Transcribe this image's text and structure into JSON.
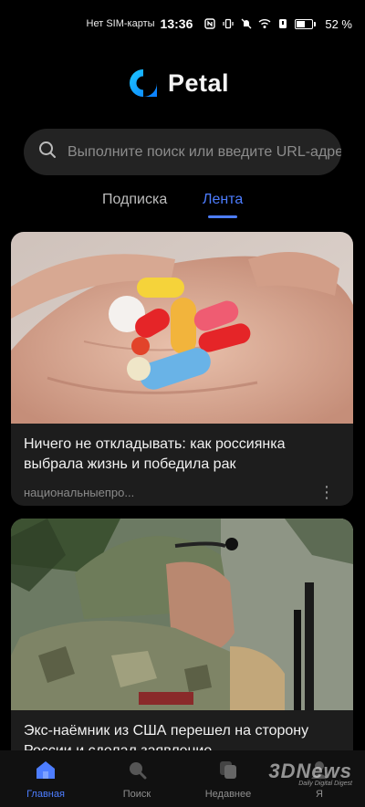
{
  "status_bar": {
    "carrier": "Нет SIM-карты",
    "time": "13:36",
    "battery_percent_text": "52 %",
    "battery_level": 0.52,
    "icons": [
      "nfc-icon",
      "vibrate-icon",
      "mute-icon",
      "wifi-icon",
      "shield-icon",
      "battery-icon"
    ]
  },
  "app": {
    "logo_text": "Petal",
    "brand_color": "#16b1ff"
  },
  "search": {
    "placeholder": "Выполните поиск или введите URL-адрес"
  },
  "tabs": [
    {
      "label": "Подписка",
      "active": false
    },
    {
      "label": "Лента",
      "active": true
    }
  ],
  "accent_color": "#4d7dff",
  "feed": [
    {
      "title": "Ничего не откладывать: как россиянка выбрала жизнь и победила рак",
      "source": "национальныепро...",
      "image": "hand-holding-pills-image"
    },
    {
      "title": "Экс-наёмник из США перешел на сторону России и сделал заявление",
      "image": "soldier-with-headset-image"
    }
  ],
  "bottom_nav": [
    {
      "label": "Главная",
      "icon": "home-icon",
      "active": true
    },
    {
      "label": "Поиск",
      "icon": "search-icon",
      "active": false
    },
    {
      "label": "Недавнее",
      "icon": "recent-icon",
      "active": false
    },
    {
      "label": "Я",
      "icon": "profile-icon",
      "active": false
    }
  ],
  "watermark": {
    "brand": "3DNews",
    "tagline": "Daily Digital Digest"
  }
}
